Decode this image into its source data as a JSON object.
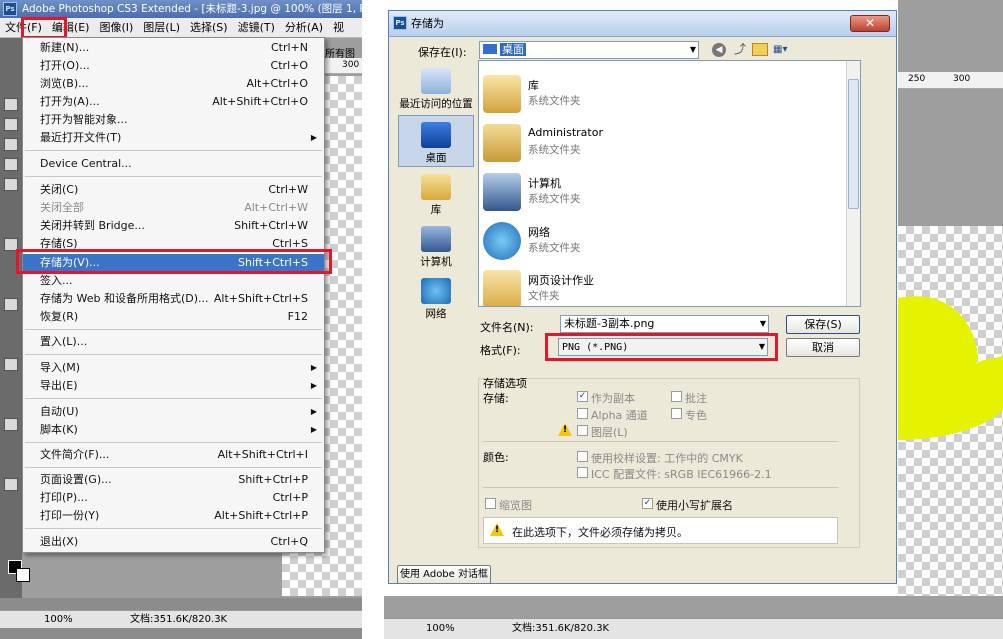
{
  "left": {
    "app_title": "Adobe Photoshop CS3 Extended - [未标题-3.jpg @ 100% (图层 1, R",
    "ps_icon": "Ps",
    "menubar": [
      "文件(F)",
      "编辑(E)",
      "图像(I)",
      "图层(L)",
      "选择(S)",
      "滤镜(T)",
      "分析(A)",
      "视"
    ],
    "doc_fragment": "所有图",
    "ruler_marks": [
      "300"
    ],
    "file_menu": [
      {
        "label": "新建(N)...",
        "shortcut": "Ctrl+N"
      },
      {
        "label": "打开(O)...",
        "shortcut": "Ctrl+O"
      },
      {
        "label": "浏览(B)...",
        "shortcut": "Alt+Ctrl+O"
      },
      {
        "label": "打开为(A)...",
        "shortcut": "Alt+Shift+Ctrl+O"
      },
      {
        "label": "打开为智能对象..."
      },
      {
        "label": "最近打开文件(T)",
        "submenu": true
      },
      {
        "label": "Device Central..."
      },
      {
        "label": "关闭(C)",
        "shortcut": "Ctrl+W"
      },
      {
        "label": "关闭全部",
        "shortcut": "Alt+Ctrl+W",
        "disabled": true
      },
      {
        "label": "关闭并转到 Bridge...",
        "shortcut": "Shift+Ctrl+W"
      },
      {
        "label": "存储(S)",
        "shortcut": "Ctrl+S"
      },
      {
        "label": "存储为(V)...",
        "shortcut": "Shift+Ctrl+S",
        "highlighted": true
      },
      {
        "label": "签入..."
      },
      {
        "label": "存储为 Web 和设备所用格式(D)...",
        "shortcut": "Alt+Shift+Ctrl+S"
      },
      {
        "label": "恢复(R)",
        "shortcut": "F12"
      },
      {
        "label": "置入(L)..."
      },
      {
        "label": "导入(M)",
        "submenu": true
      },
      {
        "label": "导出(E)",
        "submenu": true
      },
      {
        "label": "自动(U)",
        "submenu": true
      },
      {
        "label": "脚本(K)",
        "submenu": true
      },
      {
        "label": "文件简介(F)...",
        "shortcut": "Alt+Shift+Ctrl+I"
      },
      {
        "label": "页面设置(G)...",
        "shortcut": "Shift+Ctrl+P"
      },
      {
        "label": "打印(P)...",
        "shortcut": "Ctrl+P"
      },
      {
        "label": "打印一份(Y)",
        "shortcut": "Alt+Shift+Ctrl+P"
      },
      {
        "label": "退出(X)",
        "shortcut": "Ctrl+Q"
      }
    ],
    "status": {
      "zoom": "100%",
      "doc": "文档:351.6K/820.3K"
    }
  },
  "right": {
    "dialog_title": "存储为",
    "save_in_label": "保存在(I):",
    "save_in_value": "桌面",
    "places": [
      "最近访问的位置",
      "桌面",
      "库",
      "计算机",
      "网络"
    ],
    "files": [
      {
        "name": "库",
        "type": "系统文件夹",
        "icon": "library-icon"
      },
      {
        "name": "Administrator",
        "type": "系统文件夹",
        "icon": "user-folder-icon"
      },
      {
        "name": "计算机",
        "type": "系统文件夹",
        "icon": "computer-icon"
      },
      {
        "name": "网络",
        "type": "系统文件夹",
        "icon": "network-icon"
      },
      {
        "name": "网页设计作业",
        "type": "文件夹",
        "icon": "folder-icon"
      }
    ],
    "filename_label": "文件名(N):",
    "filename_value": "未标题-3副本.png",
    "format_label": "格式(F):",
    "format_value": "PNG (*.PNG)",
    "save_button": "保存(S)",
    "cancel_button": "取消",
    "save_options_title": "存储选项",
    "save_label": "存储:",
    "as_copy": "作为副本",
    "notes": "批注",
    "alpha": "Alpha 通道",
    "spot": "专色",
    "layers": "图层(L)",
    "color_label": "颜色:",
    "use_proof": "使用校样设置: 工作中的 CMYK",
    "icc": "ICC 配置文件: sRGB IEC61966-2.1",
    "thumbnail": "缩览图",
    "lowercase_ext": "使用小写扩展名",
    "warning": "在此选项下，文件必须存储为拷贝。",
    "adobe_dialog_button": "使用 Adobe 对话框",
    "ruler_marks": [
      "250",
      "300"
    ],
    "status": {
      "zoom": "100%",
      "doc": "文档:351.6K/820.3K"
    }
  },
  "colors": {
    "highlight_red": "#e0182c",
    "menu_highlight": "#3b73c8",
    "yellow_shape": "#e5f200"
  }
}
